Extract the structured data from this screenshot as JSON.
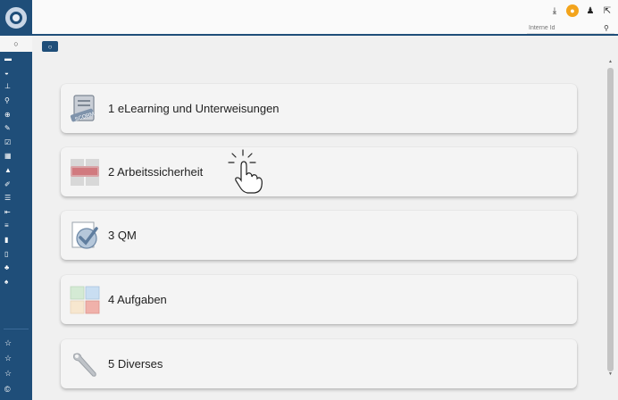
{
  "header": {
    "search": {
      "placeholder": "Interne Id"
    },
    "icons": [
      "download-icon",
      "user-avatar-icon",
      "person-icon",
      "external-link-icon"
    ]
  },
  "sidebar": {
    "first_icon": "circle-icon",
    "icons": [
      "image-icon",
      "dashboard-icon",
      "sitemap-icon",
      "search-icon",
      "zoom-icon",
      "pencil-icon",
      "check-square-icon",
      "grid-icon",
      "graduation-cap-icon",
      "edit-icon",
      "list-icon",
      "sign-out-icon",
      "menu-icon",
      "file-icon",
      "file-outline-icon",
      "users-icon",
      "bird-icon"
    ],
    "stars": [
      "star-icon",
      "star-icon",
      "star-icon",
      "star-icon"
    ]
  },
  "tab": {
    "label": "○"
  },
  "cards": [
    {
      "label": "1 eLearning und Unterweisungen",
      "icon": "scorm-book-icon"
    },
    {
      "label": "2 Arbeitssicherheit",
      "icon": "safety-icon"
    },
    {
      "label": "3 QM",
      "icon": "checkmark-icon"
    },
    {
      "label": "4 Aufgaben",
      "icon": "tiles-icon"
    },
    {
      "label": "5 Diverses",
      "icon": "wrench-icon"
    }
  ],
  "colors": {
    "brand": "#1f4e79",
    "background": "#f0f0f0",
    "card": "#f4f4f4",
    "avatar": "#f3a41c"
  }
}
